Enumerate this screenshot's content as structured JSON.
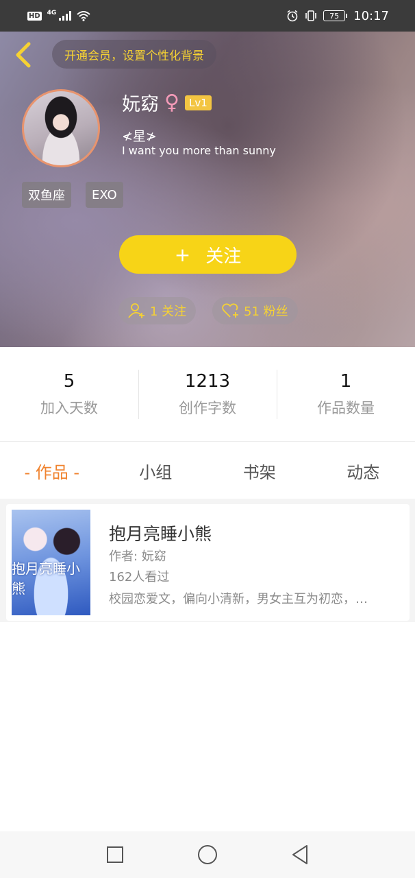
{
  "status_bar": {
    "hd": "HD",
    "network": "4G",
    "battery": "75",
    "time": "10:17"
  },
  "header": {
    "vip_banner": "开通会员，设置个性化背景",
    "username": "妧窈",
    "gender_symbol": "♀",
    "level": "Lv1",
    "signature_title": "≮星≯",
    "signature_text": "I want you more than sunny",
    "tags": [
      "双鱼座",
      "EXO"
    ],
    "follow_plus": "+",
    "follow_label": "关注",
    "following_pill": "1 关注",
    "fans_pill": "51 粉丝"
  },
  "stats": [
    {
      "value": "5",
      "label": "加入天数"
    },
    {
      "value": "1213",
      "label": "创作字数"
    },
    {
      "value": "1",
      "label": "作品数量"
    }
  ],
  "tabs": [
    "- 作品 -",
    "小组",
    "书架",
    "动态"
  ],
  "book": {
    "cover_text": "抱月亮睡小熊",
    "title": "抱月亮睡小熊",
    "author": "作者: 妧窈",
    "views": "162人看过",
    "description": "校园恋爱文，偏向小清新，男女主互为初恋，…"
  },
  "colors": {
    "accent_yellow": "#f7d417",
    "tab_active": "#f0832f"
  }
}
